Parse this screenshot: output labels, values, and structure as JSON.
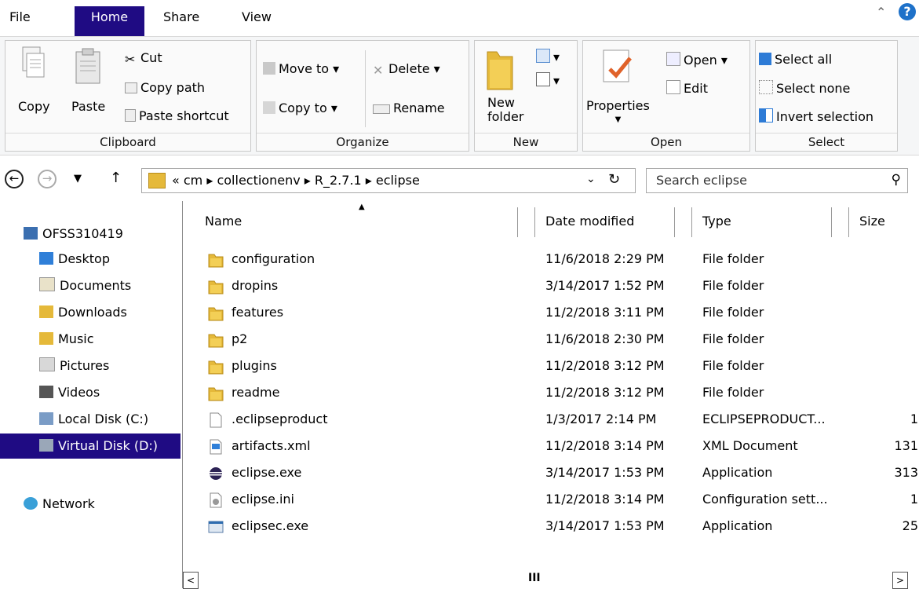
{
  "tabs": {
    "file": "File",
    "home": "Home",
    "share": "Share",
    "view": "View"
  },
  "ribbon": {
    "clipboard": {
      "label": "Clipboard",
      "copy": "Copy",
      "paste": "Paste",
      "cut": "Cut",
      "copy_path": "Copy path",
      "paste_shortcut": "Paste shortcut"
    },
    "organize": {
      "label": "Organize",
      "move_to": "Move to ▾",
      "copy_to": "Copy to ▾",
      "delete": "Delete ▾",
      "rename": "Rename"
    },
    "new": {
      "label": "New",
      "new_folder_line1": "New",
      "new_folder_line2": "folder"
    },
    "open": {
      "label": "Open",
      "properties": "Properties",
      "open": "Open ▾",
      "edit": "Edit"
    },
    "select": {
      "label": "Select",
      "select_all": "Select all",
      "select_none": "Select none",
      "invert": "Invert selection"
    }
  },
  "address": {
    "crumbs": "« cm ▸ collectionenv ▸ R_2.7.1 ▸ eclipse",
    "search_placeholder": "Search eclipse"
  },
  "navpane": {
    "computer": "OFSS310419",
    "items": [
      {
        "label": "Desktop"
      },
      {
        "label": "Documents"
      },
      {
        "label": "Downloads"
      },
      {
        "label": "Music"
      },
      {
        "label": "Pictures"
      },
      {
        "label": "Videos"
      },
      {
        "label": "Local Disk (C:)"
      },
      {
        "label": "Virtual Disk (D:)"
      }
    ],
    "network": "Network"
  },
  "columns": {
    "name": "Name",
    "date": "Date modified",
    "type": "Type",
    "size": "Size"
  },
  "files": [
    {
      "name": "configuration",
      "date": "11/6/2018 2:29 PM",
      "type": "File folder",
      "size": "",
      "icon": "folder-icon"
    },
    {
      "name": "dropins",
      "date": "3/14/2017 1:52 PM",
      "type": "File folder",
      "size": "",
      "icon": "folder-icon"
    },
    {
      "name": "features",
      "date": "11/2/2018 3:11 PM",
      "type": "File folder",
      "size": "",
      "icon": "folder-icon"
    },
    {
      "name": "p2",
      "date": "11/6/2018 2:30 PM",
      "type": "File folder",
      "size": "",
      "icon": "folder-icon"
    },
    {
      "name": "plugins",
      "date": "11/2/2018 3:12 PM",
      "type": "File folder",
      "size": "",
      "icon": "folder-icon"
    },
    {
      "name": "readme",
      "date": "11/2/2018 3:12 PM",
      "type": "File folder",
      "size": "",
      "icon": "folder-icon"
    },
    {
      "name": ".eclipseproduct",
      "date": "1/3/2017 2:14 PM",
      "type": "ECLIPSEPRODUCT...",
      "size": "1",
      "icon": "file-icon"
    },
    {
      "name": "artifacts.xml",
      "date": "11/2/2018 3:14 PM",
      "type": "XML Document",
      "size": "131",
      "icon": "xml-file-icon"
    },
    {
      "name": "eclipse.exe",
      "date": "3/14/2017 1:53 PM",
      "type": "Application",
      "size": "313",
      "icon": "eclipse-app-icon"
    },
    {
      "name": "eclipse.ini",
      "date": "11/2/2018 3:14 PM",
      "type": "Configuration sett...",
      "size": "1",
      "icon": "config-file-icon"
    },
    {
      "name": "eclipsec.exe",
      "date": "3/14/2017 1:53 PM",
      "type": "Application",
      "size": "25",
      "icon": "app-icon"
    }
  ],
  "scroll": {
    "thumb": "III"
  }
}
